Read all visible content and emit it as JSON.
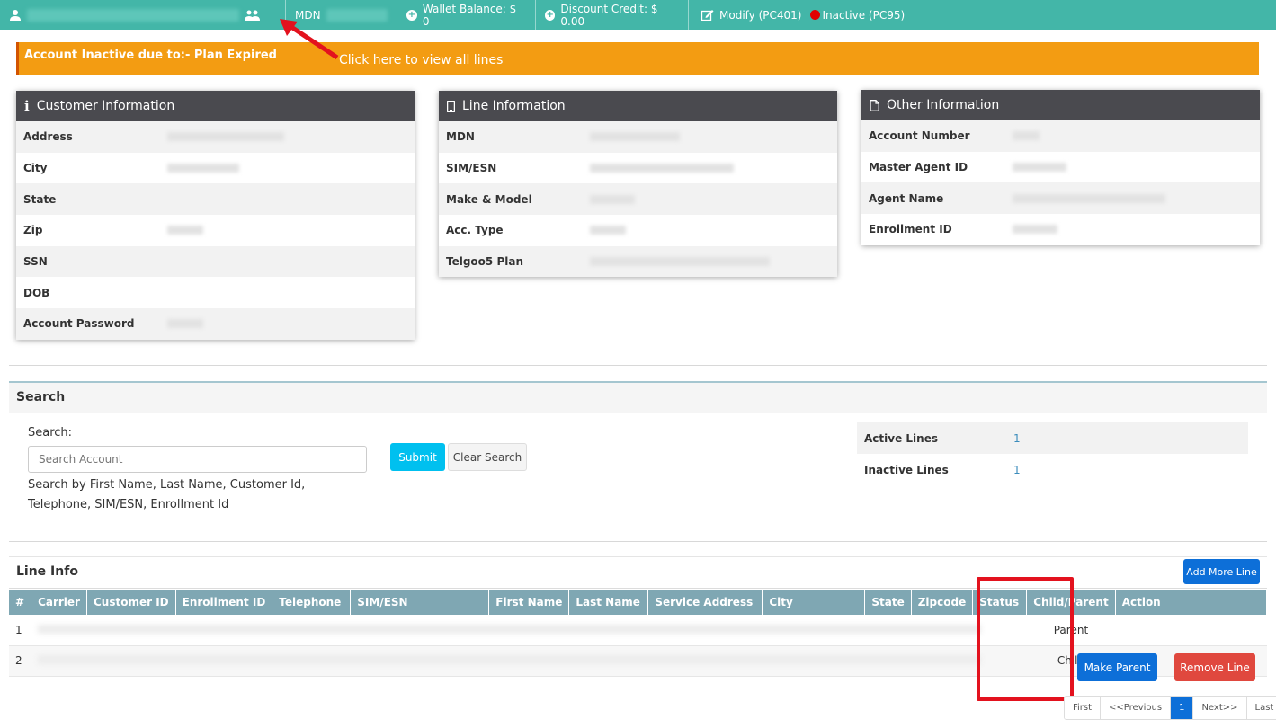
{
  "topbar": {
    "mdn_label": "MDN",
    "wallet_balance": "Wallet Balance: $ 0",
    "discount_credit": "Discount Credit: $ 0.00",
    "modify": "Modify (PC401)",
    "status": "Inactive (PC95)"
  },
  "alert": {
    "text": "Account Inactive due to:- Plan Expired"
  },
  "annotation": {
    "text": "Click here to view all lines"
  },
  "customer_info": {
    "title": "Customer Information",
    "rows": [
      "Address",
      "City",
      "State",
      "Zip",
      "SSN",
      "DOB",
      "Account Password"
    ]
  },
  "line_info_panel": {
    "title": "Line Information",
    "rows": [
      "MDN",
      "SIM/ESN",
      "Make & Model",
      "Acc. Type",
      "Telgoo5 Plan"
    ]
  },
  "other_info": {
    "title": "Other Information",
    "rows": [
      "Account Number",
      "Master Agent ID",
      "Agent Name",
      "Enrollment ID"
    ]
  },
  "search": {
    "title": "Search",
    "label": "Search:",
    "placeholder": "Search Account",
    "help": "Search by First Name, Last Name, Customer Id, Telephone, SIM/ESN, Enrollment Id",
    "submit": "Submit",
    "clear": "Clear Search",
    "active_label": "Active Lines",
    "active_value": "1",
    "inactive_label": "Inactive Lines",
    "inactive_value": "1"
  },
  "line_table": {
    "title": "Line Info",
    "add_button": "Add More Line",
    "headers": [
      "#",
      "Carrier",
      "Customer ID",
      "Enrollment ID",
      "Telephone",
      "SIM/ESN",
      "First Name",
      "Last Name",
      "Service Address",
      "City",
      "State",
      "Zipcode",
      "Status",
      "Child/Parent",
      "Action"
    ],
    "rows": [
      {
        "num": "1",
        "relation": "Parent"
      },
      {
        "num": "2",
        "relation": "Child"
      }
    ],
    "make_parent": "Make Parent",
    "remove_line": "Remove Line"
  },
  "pager": {
    "first": "First",
    "prev": "<<Previous",
    "current": "1",
    "next": "Next>>",
    "last": "Last"
  },
  "colors": {
    "topbar": "#43b6a8",
    "alert": "#f39c12",
    "panel_header": "#4a4a4f",
    "table_header": "#7fa7b3",
    "primary": "#0d6fd8",
    "danger": "#e0483e",
    "highlight": "#e3121e"
  }
}
